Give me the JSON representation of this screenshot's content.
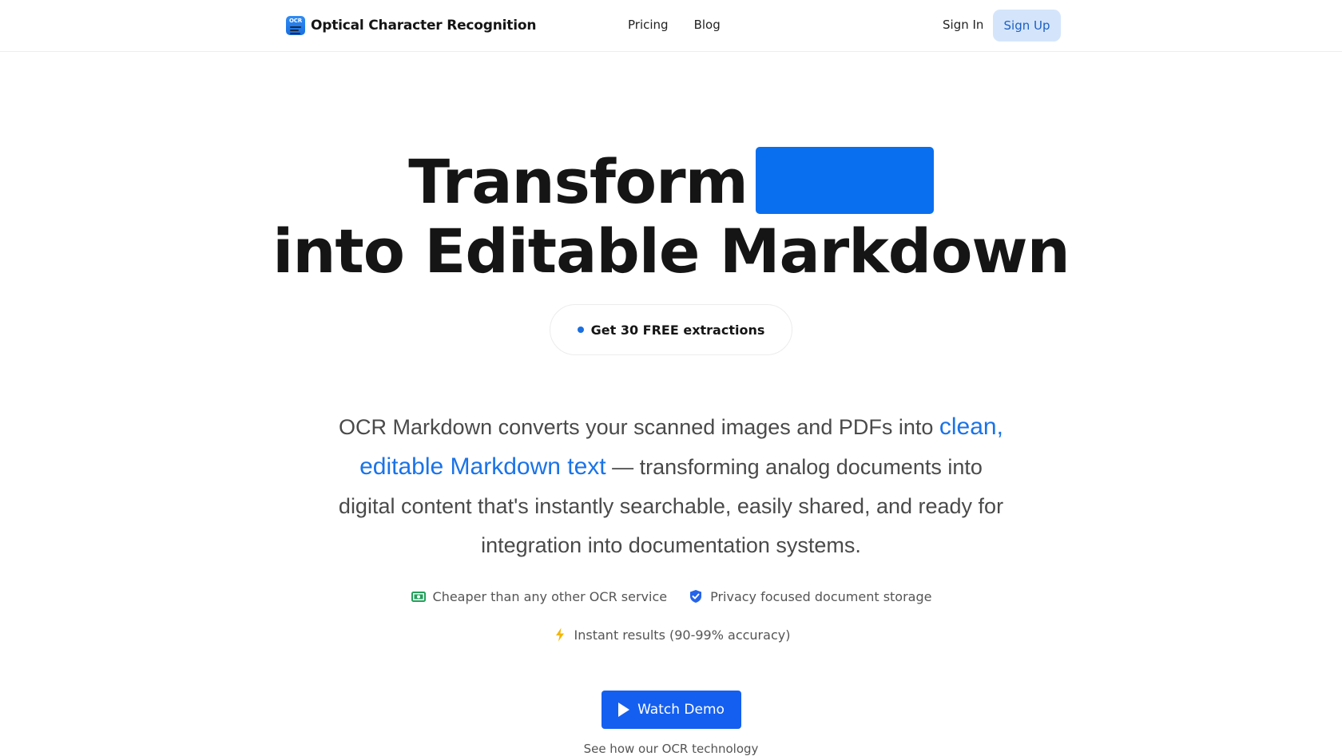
{
  "nav": {
    "brand_name": "Optical Character Recognition",
    "logo_text": "OCR",
    "links": [
      "Pricing",
      "Blog"
    ],
    "sign_in": "Sign In",
    "sign_up": "Sign Up"
  },
  "hero": {
    "line1": "Transform",
    "line2": "into Editable Markdown",
    "highlight_color": "#0a6fef"
  },
  "pill": {
    "text": "Get 30 FREE extractions"
  },
  "description": {
    "part1": "OCR Markdown converts your scanned images and PDFs into ",
    "highlight": "clean, editable Markdown text",
    "part2": " — transforming analog documents into digital content that's instantly searchable, easily shared, and ready for integration into documentation systems.",
    "highlight_color": "#1a73e8"
  },
  "features": [
    {
      "icon": "money-icon",
      "text": "Cheaper than any other OCR service"
    },
    {
      "icon": "shield-check-icon",
      "text": "Privacy focused document storage"
    },
    {
      "icon": "lightning-icon",
      "text": "Instant results (90-99% accuracy)"
    }
  ],
  "cta": {
    "button": "Watch Demo",
    "caption": "See how our OCR technology"
  }
}
